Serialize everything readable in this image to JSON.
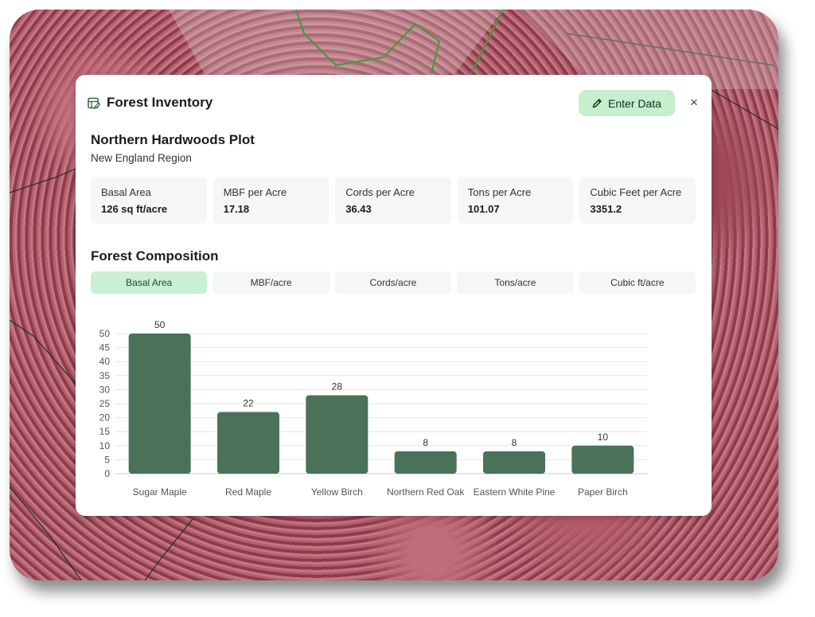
{
  "header": {
    "title": "Forest Inventory",
    "enter_label": "Enter Data",
    "close_glyph": "×"
  },
  "plot": {
    "title": "Northern Hardwoods Plot",
    "region": "New England Region"
  },
  "stats": [
    {
      "label": "Basal Area",
      "value": "126 sq ft/acre"
    },
    {
      "label": "MBF per Acre",
      "value": "17.18"
    },
    {
      "label": "Cords per Acre",
      "value": "36.43"
    },
    {
      "label": "Tons per Acre",
      "value": "101.07"
    },
    {
      "label": "Cubic Feet per Acre",
      "value": "3351.2"
    }
  ],
  "composition": {
    "title": "Forest Composition",
    "tabs": [
      "Basal Area",
      "MBF/acre",
      "Cords/acre",
      "Tons/acre",
      "Cubic ft/acre"
    ],
    "active_tab": 0
  },
  "chart_data": {
    "type": "bar",
    "categories": [
      "Sugar Maple",
      "Red Maple",
      "Yellow Birch",
      "Northern Red Oak",
      "Eastern White Pine",
      "Paper Birch"
    ],
    "values": [
      50,
      22,
      28,
      8,
      8,
      10
    ],
    "ylim": [
      0,
      50
    ],
    "yticks": [
      0,
      5,
      10,
      15,
      20,
      25,
      30,
      35,
      40,
      45,
      50
    ],
    "bar_color": "#4a7259",
    "grid": true
  },
  "colors": {
    "accent": "#c5efcf",
    "bar": "#4a7259"
  },
  "icons": {
    "header": "table-edit-icon",
    "button": "pencil-icon",
    "close": "close-icon"
  }
}
